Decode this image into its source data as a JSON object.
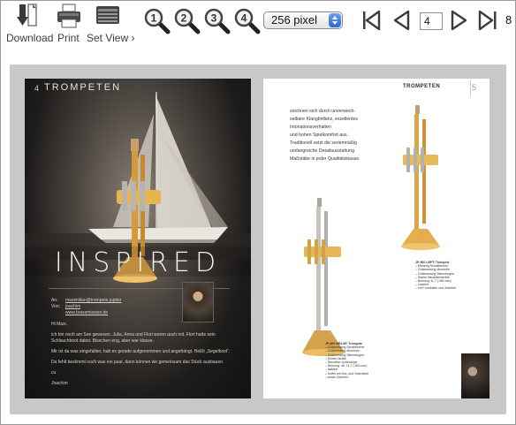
{
  "toolbar": {
    "download_label": "Download",
    "print_label": "Print",
    "setview_label": "Set View ›",
    "zoom_levels": [
      "1",
      "2",
      "3",
      "4"
    ],
    "zoom_select": "256 pixel",
    "page_input": "4",
    "total_pages": "8"
  },
  "left_page": {
    "number": "4",
    "title": "TROMPETEN",
    "headline": "INSPIRED",
    "email": {
      "to_label": "An:",
      "to_value": "maximilian@trompete.jupiter",
      "from_label": "Von:",
      "from_value": "joachim",
      "web": "www.brassmission.de"
    },
    "letter": [
      "Hi Maxi,",
      "ich bin noch am See gewesen. Julia, Anna und Flori waren auch mit. Flori hatte sein Schlauchboot dabei. Bisschen eng, aber war klasse.",
      "Mir ist da was eingefallen, hab es gerade aufgenommen und angehängt. Heißt „Segelboot“.",
      "Da fehlt bestimmt noch was ein paar, dann können wir gemeinsam das Stück ausbauen.",
      "cu",
      "Joachim"
    ]
  },
  "right_page": {
    "title": "TROMPETEN",
    "number": "5",
    "intro": [
      "zeichnen sich durch unverwech-",
      "selbare Klangbrillanz, exzellentes",
      "Intonationsverhalten",
      "und hohen Spielkomfort aus.",
      "Traditionell setzt die serienmäßig",
      "umfangreiche Detailausstattung",
      "Maßstäbe in jeder Qualitätsklasse."
    ],
    "spec_upper": {
      "title": "JP-900 LBP® Trompete",
      "items": [
        "– Messing Schallbecher",
        "– Goldmessing Mundrohr",
        "– Goldmessing Stimmbogen",
        "– Starke Neusilberventile",
        "– Bohrung 11,7 (.460 mm)",
        "– Lackiert",
        "– mit Formkoffer und Zubehör"
      ]
    },
    "spec_lower": {
      "title": "JP-600 MBL/II® Trompete",
      "items": [
        "– Goldmessing Schallbecher",
        "– Goldmessing Mundrohr",
        "– Goldmessing Stimmbogen",
        "– Monel Ventile",
        "– Neusilber Außenzüge",
        "– Bohrung .46, 11,7 (.460 mm)",
        "– lackiert",
        "– Koffer mit Hut- und Notenfach",
        "– sowie Zubehör"
      ]
    }
  }
}
